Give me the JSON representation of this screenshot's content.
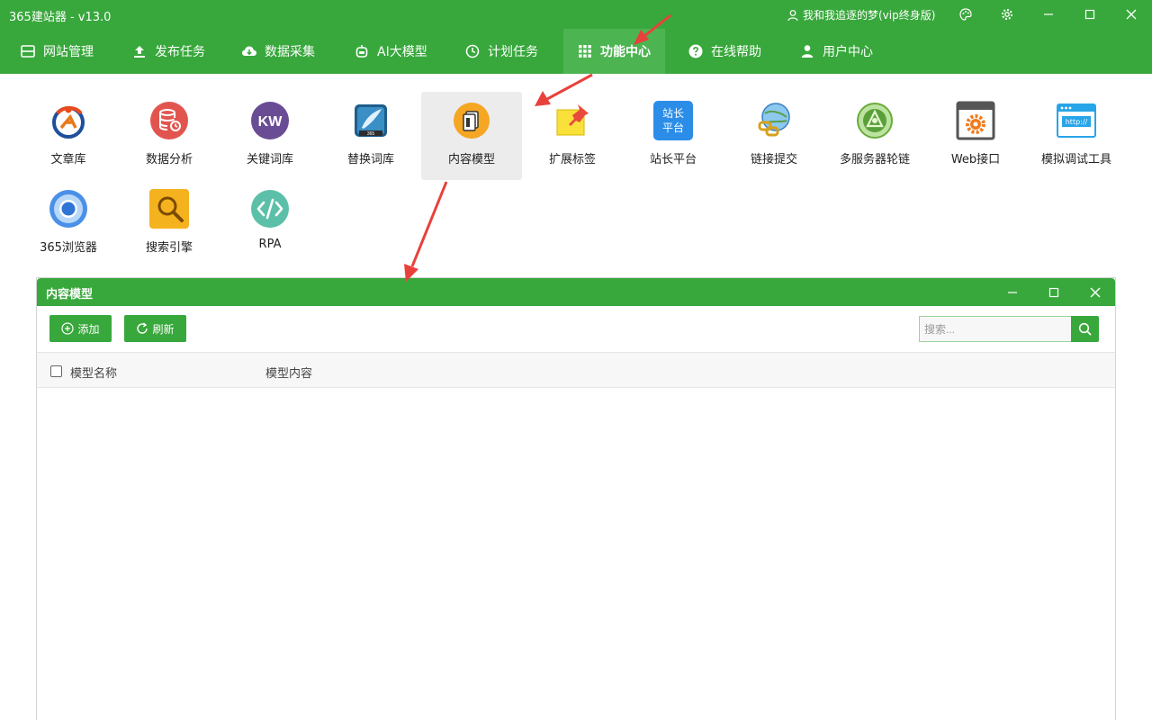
{
  "app": {
    "title": "365建站器 - v13.0",
    "user": "我和我追逐的梦(vip终身版)"
  },
  "menu": [
    {
      "label": "网站管理",
      "icon": "window-icon"
    },
    {
      "label": "发布任务",
      "icon": "upload-icon"
    },
    {
      "label": "数据采集",
      "icon": "cloud-download-icon"
    },
    {
      "label": "AI大模型",
      "icon": "robot-icon"
    },
    {
      "label": "计划任务",
      "icon": "clock-icon"
    },
    {
      "label": "功能中心",
      "icon": "grid-icon",
      "active": true
    },
    {
      "label": "在线帮助",
      "icon": "question-icon"
    },
    {
      "label": "用户中心",
      "icon": "user-icon"
    }
  ],
  "tools": [
    {
      "label": "文章库",
      "icon": "article-library-icon"
    },
    {
      "label": "数据分析",
      "icon": "database-analysis-icon"
    },
    {
      "label": "关键词库",
      "icon": "keyword-icon"
    },
    {
      "label": "替换词库",
      "icon": "replace-word-icon"
    },
    {
      "label": "内容模型",
      "icon": "content-model-icon",
      "selected": true
    },
    {
      "label": "扩展标签",
      "icon": "pin-tag-icon"
    },
    {
      "label": "站长平台",
      "icon": "webmaster-platform-icon",
      "icon_text": [
        "站长",
        "平台"
      ]
    },
    {
      "label": "链接提交",
      "icon": "link-submit-icon"
    },
    {
      "label": "多服务器轮链",
      "icon": "multi-server-icon"
    },
    {
      "label": "Web接口",
      "icon": "web-api-gear-icon"
    },
    {
      "label": "模拟调试工具",
      "icon": "http-debug-icon",
      "icon_text": [
        "http://"
      ]
    },
    {
      "label": "365浏览器",
      "icon": "browser-icon"
    },
    {
      "label": "搜索引擎",
      "icon": "search-engine-icon"
    },
    {
      "label": "RPA",
      "icon": "code-icon"
    }
  ],
  "panel": {
    "title": "内容模型",
    "add_label": "添加",
    "refresh_label": "刷新",
    "search_placeholder": "搜索...",
    "columns": [
      "模型名称",
      "模型内容"
    ],
    "rows": []
  },
  "colors": {
    "brand_green": "#38a83c",
    "active_menu": "#4cb450",
    "arrow_red": "#e8413c"
  }
}
